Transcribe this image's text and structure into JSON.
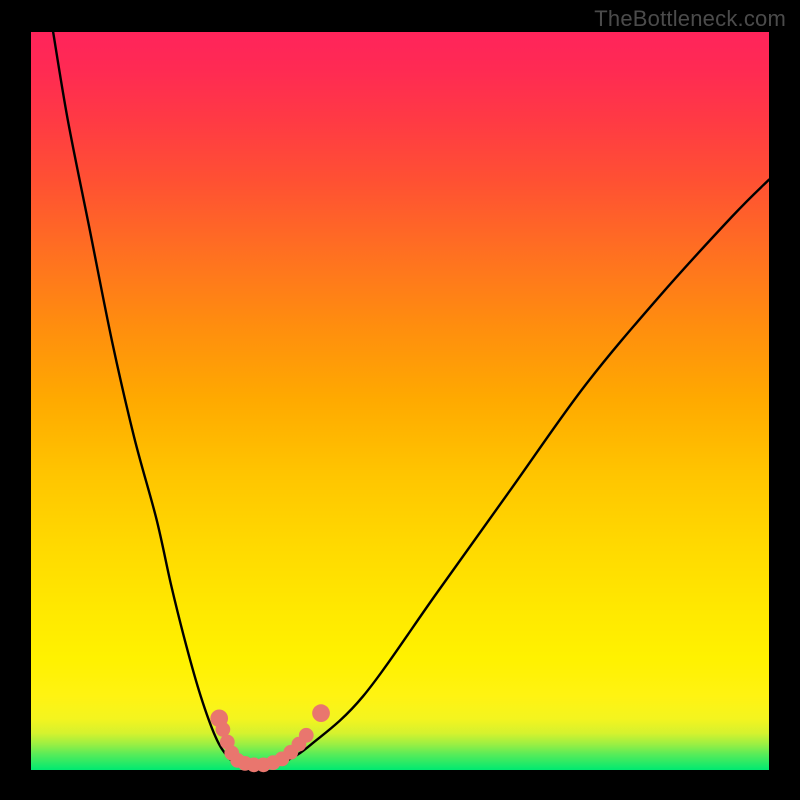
{
  "attribution": "TheBottleneck.com",
  "colors": {
    "frame": "#000000",
    "gradient_top": "#ff245b",
    "gradient_mid": "#fff200",
    "gradient_bottom": "#00e971",
    "curve": "#000000",
    "markers": "#e9766e"
  },
  "chart_data": {
    "type": "line",
    "title": "",
    "xlabel": "",
    "ylabel": "",
    "xlim": [
      0,
      100
    ],
    "ylim": [
      0,
      100
    ],
    "series": [
      {
        "name": "bottleneck-curve",
        "x": [
          3,
          5,
          8,
          11,
          14,
          17,
          19,
          21,
          23,
          25,
          26.5,
          28,
          30,
          32,
          34.5,
          38,
          45,
          55,
          65,
          75,
          85,
          95,
          100
        ],
        "y": [
          100,
          88,
          73,
          58,
          45,
          34,
          25,
          17,
          10,
          4.5,
          2,
          0.7,
          0.5,
          0.6,
          1.2,
          3.5,
          10,
          24,
          38,
          52,
          64,
          75,
          80
        ]
      }
    ],
    "markers": [
      {
        "x": 25.5,
        "y": 7.0,
        "r": 1.2
      },
      {
        "x": 26.0,
        "y": 5.5,
        "r": 1.0
      },
      {
        "x": 26.6,
        "y": 3.8,
        "r": 1.0
      },
      {
        "x": 27.2,
        "y": 2.3,
        "r": 1.0
      },
      {
        "x": 28.0,
        "y": 1.3,
        "r": 1.0
      },
      {
        "x": 29.0,
        "y": 0.9,
        "r": 1.0
      },
      {
        "x": 30.2,
        "y": 0.7,
        "r": 1.0
      },
      {
        "x": 31.5,
        "y": 0.7,
        "r": 1.0
      },
      {
        "x": 32.8,
        "y": 1.0,
        "r": 1.0
      },
      {
        "x": 34.0,
        "y": 1.5,
        "r": 1.0
      },
      {
        "x": 35.2,
        "y": 2.4,
        "r": 1.0
      },
      {
        "x": 36.3,
        "y": 3.5,
        "r": 1.0
      },
      {
        "x": 37.3,
        "y": 4.7,
        "r": 1.0
      },
      {
        "x": 39.3,
        "y": 7.7,
        "r": 1.2
      }
    ],
    "annotations": []
  }
}
